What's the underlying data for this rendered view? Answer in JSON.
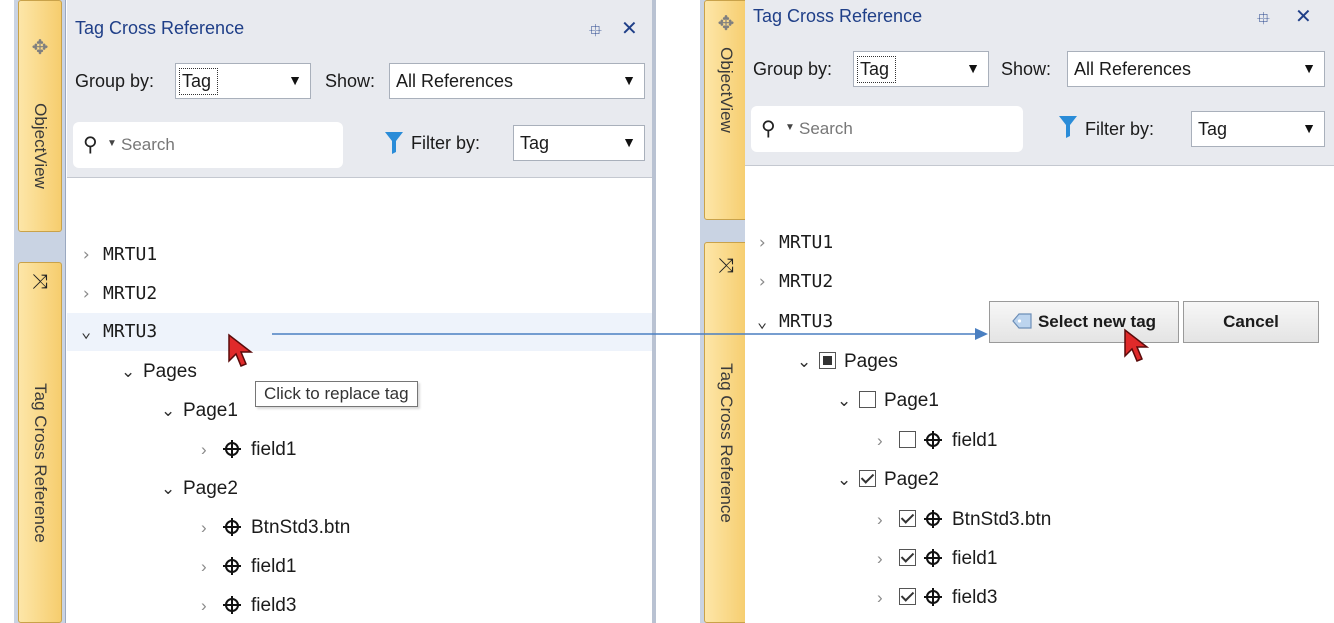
{
  "left": {
    "rail": {
      "top_tab": "ObjectView",
      "bottom_tab": "Tag Cross Reference"
    },
    "title": "Tag Cross Reference",
    "pin": "⯐",
    "close": "✕",
    "group_by_label": "Group by:",
    "group_by_value": "Tag",
    "show_label": "Show:",
    "show_value": "All References",
    "search_placeholder": "Search",
    "filter_label": "Filter by:",
    "filter_value": "Tag",
    "tree": {
      "mrtu1": "MRTU1",
      "mrtu2": "MRTU2",
      "mrtu3": "MRTU3",
      "pages": "Pages",
      "page1": "Page1",
      "page1_field1": "field1",
      "page2": "Page2",
      "btn": "BtnStd3.btn",
      "page2_field1": "field1",
      "page2_field3": "field3"
    },
    "tooltip": "Click to replace tag"
  },
  "right": {
    "rail": {
      "top_tab": "ObjectView",
      "bottom_tab": "Tag Cross Reference"
    },
    "title": "Tag Cross Reference",
    "pin": "⯐",
    "close": "✕",
    "group_by_label": "Group by:",
    "group_by_value": "Tag",
    "show_label": "Show:",
    "show_value": "All References",
    "search_placeholder": "Search",
    "filter_label": "Filter by:",
    "filter_value": "Tag",
    "tree": {
      "mrtu1": "MRTU1",
      "mrtu2": "MRTU2",
      "mrtu3": "MRTU3",
      "pages": "Pages",
      "page1": "Page1",
      "page1_field1": "field1",
      "page2": "Page2",
      "btn": "BtnStd3.btn",
      "page2_field1": "field1",
      "page2_field3": "field3"
    },
    "select_new_tag": "Select new tag",
    "cancel": "Cancel"
  },
  "icons": {
    "expand_closed": "›",
    "expand_open": "⌄",
    "search": "search-icon",
    "filter": "filter-icon",
    "target": "target-icon",
    "shuffle": "shuffle-icon"
  },
  "colors": {
    "title_blue": "#1f3f88",
    "rail_tab": "#f6cd6e",
    "arrow": "#4a7fc1",
    "cursor_red": "#e02a2a"
  }
}
